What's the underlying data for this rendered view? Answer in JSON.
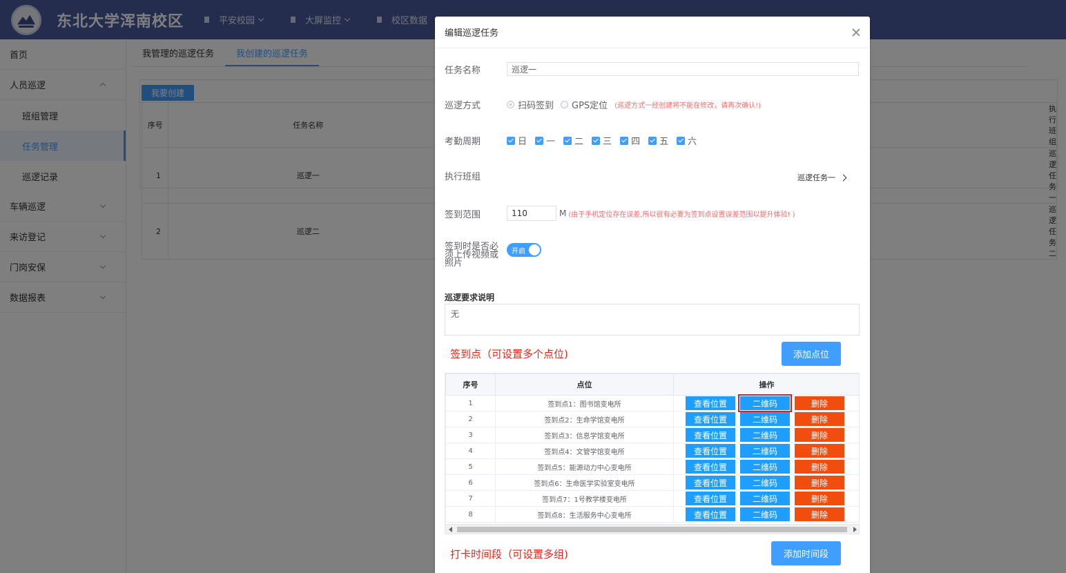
{
  "header": {
    "site_title": "东北大学浑南校区",
    "nav": [
      "平安校园",
      "大屏监控",
      "校区数据"
    ]
  },
  "sidebar": {
    "items": [
      {
        "label": "首页"
      },
      {
        "label": "人员巡逻"
      },
      {
        "label": "班组管理"
      },
      {
        "label": "任务管理"
      },
      {
        "label": "巡逻记录"
      },
      {
        "label": "车辆巡逻"
      },
      {
        "label": "来访登记"
      },
      {
        "label": "门岗安保"
      },
      {
        "label": "数据报表"
      }
    ]
  },
  "main": {
    "tabs": [
      "我管理的巡逻任务",
      "我创建的巡逻任务"
    ],
    "create_button": "我要创建",
    "table": {
      "headers": [
        "序号",
        "任务名称",
        "执行班组"
      ],
      "rows": [
        [
          "1",
          "巡逻一",
          "巡逻任务一"
        ],
        [
          "2",
          "巡逻二",
          "巡逻任务二"
        ]
      ]
    }
  },
  "dialog": {
    "title": "编辑巡逻任务",
    "task_name_label": "任务名称",
    "task_name_value": "巡逻一",
    "mode_label": "巡逻方式",
    "mode_options": [
      "扫码签到",
      "GPS定位"
    ],
    "mode_note": "(巡逻方式一经创建将不能在修改，请再次确认!)",
    "cycle_label": "考勤周期",
    "cycle_days": [
      "日",
      "一",
      "二",
      "三",
      "四",
      "五",
      "六"
    ],
    "exec_label": "执行班组",
    "exec_value": "巡逻任务一",
    "range_label": "签到范围",
    "range_value": "110",
    "range_unit": "M",
    "range_note": "(由于手机定位存在误差,所以很有必要为签到点设置误差范围以提升体验! )",
    "media_label": "签到时是否必须上传视频或照片",
    "media_toggle": "开启",
    "desc_label": "巡逻要求说明",
    "desc_value": "无",
    "points_title": "签到点（可设置多个点位)",
    "add_point_button": "添加点位",
    "points_headers": [
      "序号",
      "点位",
      "操作"
    ],
    "points": [
      {
        "no": "1",
        "name": "签到点1：图书馆变电所"
      },
      {
        "no": "2",
        "name": "签到点2：生命学馆变电所"
      },
      {
        "no": "3",
        "name": "签到点3：信息学馆变电所"
      },
      {
        "no": "4",
        "name": "签到点4：文管学馆变电所"
      },
      {
        "no": "5",
        "name": "签到点5：能源动力中心变电所"
      },
      {
        "no": "6",
        "name": "签到点6：生命医学实验室变电所"
      },
      {
        "no": "7",
        "name": "签到点7：1号教学楼变电所"
      },
      {
        "no": "8",
        "name": "签到点8：生活服务中心变电所"
      }
    ],
    "action_labels": {
      "locate": "查看位置",
      "qrcode": "二维码",
      "delete": "删除"
    },
    "time_title": "打卡时间段（可设置多组)",
    "add_time_button": "添加时间段"
  }
}
